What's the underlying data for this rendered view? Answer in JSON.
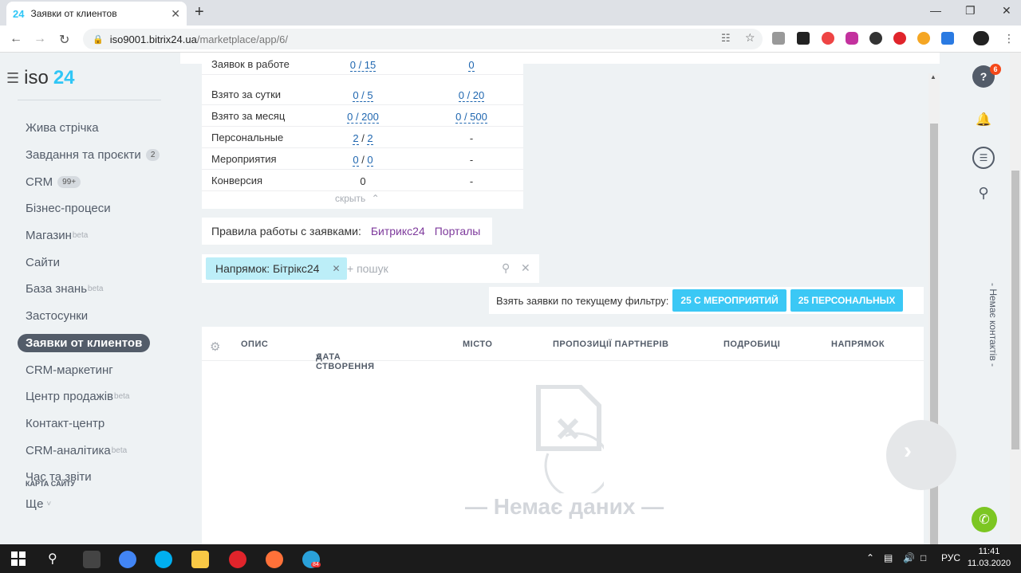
{
  "browser": {
    "tab_favicon": "24",
    "tab_title": "Заявки от клиентов",
    "tab_close": "✕",
    "new_tab": "+",
    "url_host": "iso9001.bitrix24.ua",
    "url_path": "/marketplace/app/6/",
    "win_min": "—",
    "win_max": "❐",
    "win_close": "✕"
  },
  "sidebar": {
    "logo_iso": "iso",
    "logo_num": "24",
    "items": [
      {
        "label": "Жива стрічка"
      },
      {
        "label": "Завдання та проєкти",
        "count": "2"
      },
      {
        "label": "CRM",
        "count": "99+"
      },
      {
        "label": "Бізнес-процеси"
      },
      {
        "label": "Магазин",
        "sup": "beta"
      },
      {
        "label": "Сайти"
      },
      {
        "label": "База знань",
        "sup": "beta"
      },
      {
        "label": "Застосунки"
      },
      {
        "label": "Заявки от клиентов",
        "active": true
      },
      {
        "label": "CRM-маркетинг"
      },
      {
        "label": "Центр продажів",
        "sup": "beta"
      },
      {
        "label": "Контакт-центр"
      },
      {
        "label": "CRM-аналітика",
        "sup": "beta"
      },
      {
        "label": "Час та звіти"
      },
      {
        "label": "Ще",
        "arrow": "˅"
      }
    ],
    "sitemap": "КАРТА САЙТУ"
  },
  "stats": {
    "rows": [
      {
        "name": "Заявок в работе",
        "v1": "0 / 15",
        "v2": "0"
      },
      {
        "name": "Взято за сутки",
        "v1": "0 / 5",
        "v2": "0 / 20"
      },
      {
        "name": "Взято за месяц",
        "v1": "0 / 200",
        "v2": "0 / 500"
      },
      {
        "name": "Персональные",
        "v1a": "2",
        "v1b": "2",
        "v2": "-"
      },
      {
        "name": "Мероприятия",
        "v1a": "0",
        "v1b": "0",
        "v2": "-"
      },
      {
        "name": "Конверсия",
        "v1": "0",
        "v2": "-"
      }
    ],
    "hide_label": "скрыть"
  },
  "rules": {
    "label": "Правила работы с заявками:",
    "link1": "Битрикс24",
    "link2": "Порталы"
  },
  "filter": {
    "chip": "Напрямок: Бітрікс24",
    "placeholder": "+ пошук"
  },
  "take": {
    "label": "Взять заявки по текущему фильтру:",
    "btn1": "25 С МЕРОПРИЯТИЙ",
    "btn2": "25 ПЕРСОНАЛЬНЫХ"
  },
  "grid": {
    "columns": [
      "ОПИС",
      "ДАТА СТВОРЕННЯ",
      "МІСТО",
      "ПРОПОЗИЦІЇ ПАРТНЕРІВ",
      "ПОДРОБИЦІ",
      "НАПРЯМОК"
    ],
    "empty": "— Немає даних —"
  },
  "rail": {
    "badge": "6",
    "vertical_text": "- Немає контактів -"
  },
  "taskbar": {
    "lang": "РУС",
    "time": "11:41",
    "date": "11.03.2020",
    "telegram_badge": "84"
  }
}
